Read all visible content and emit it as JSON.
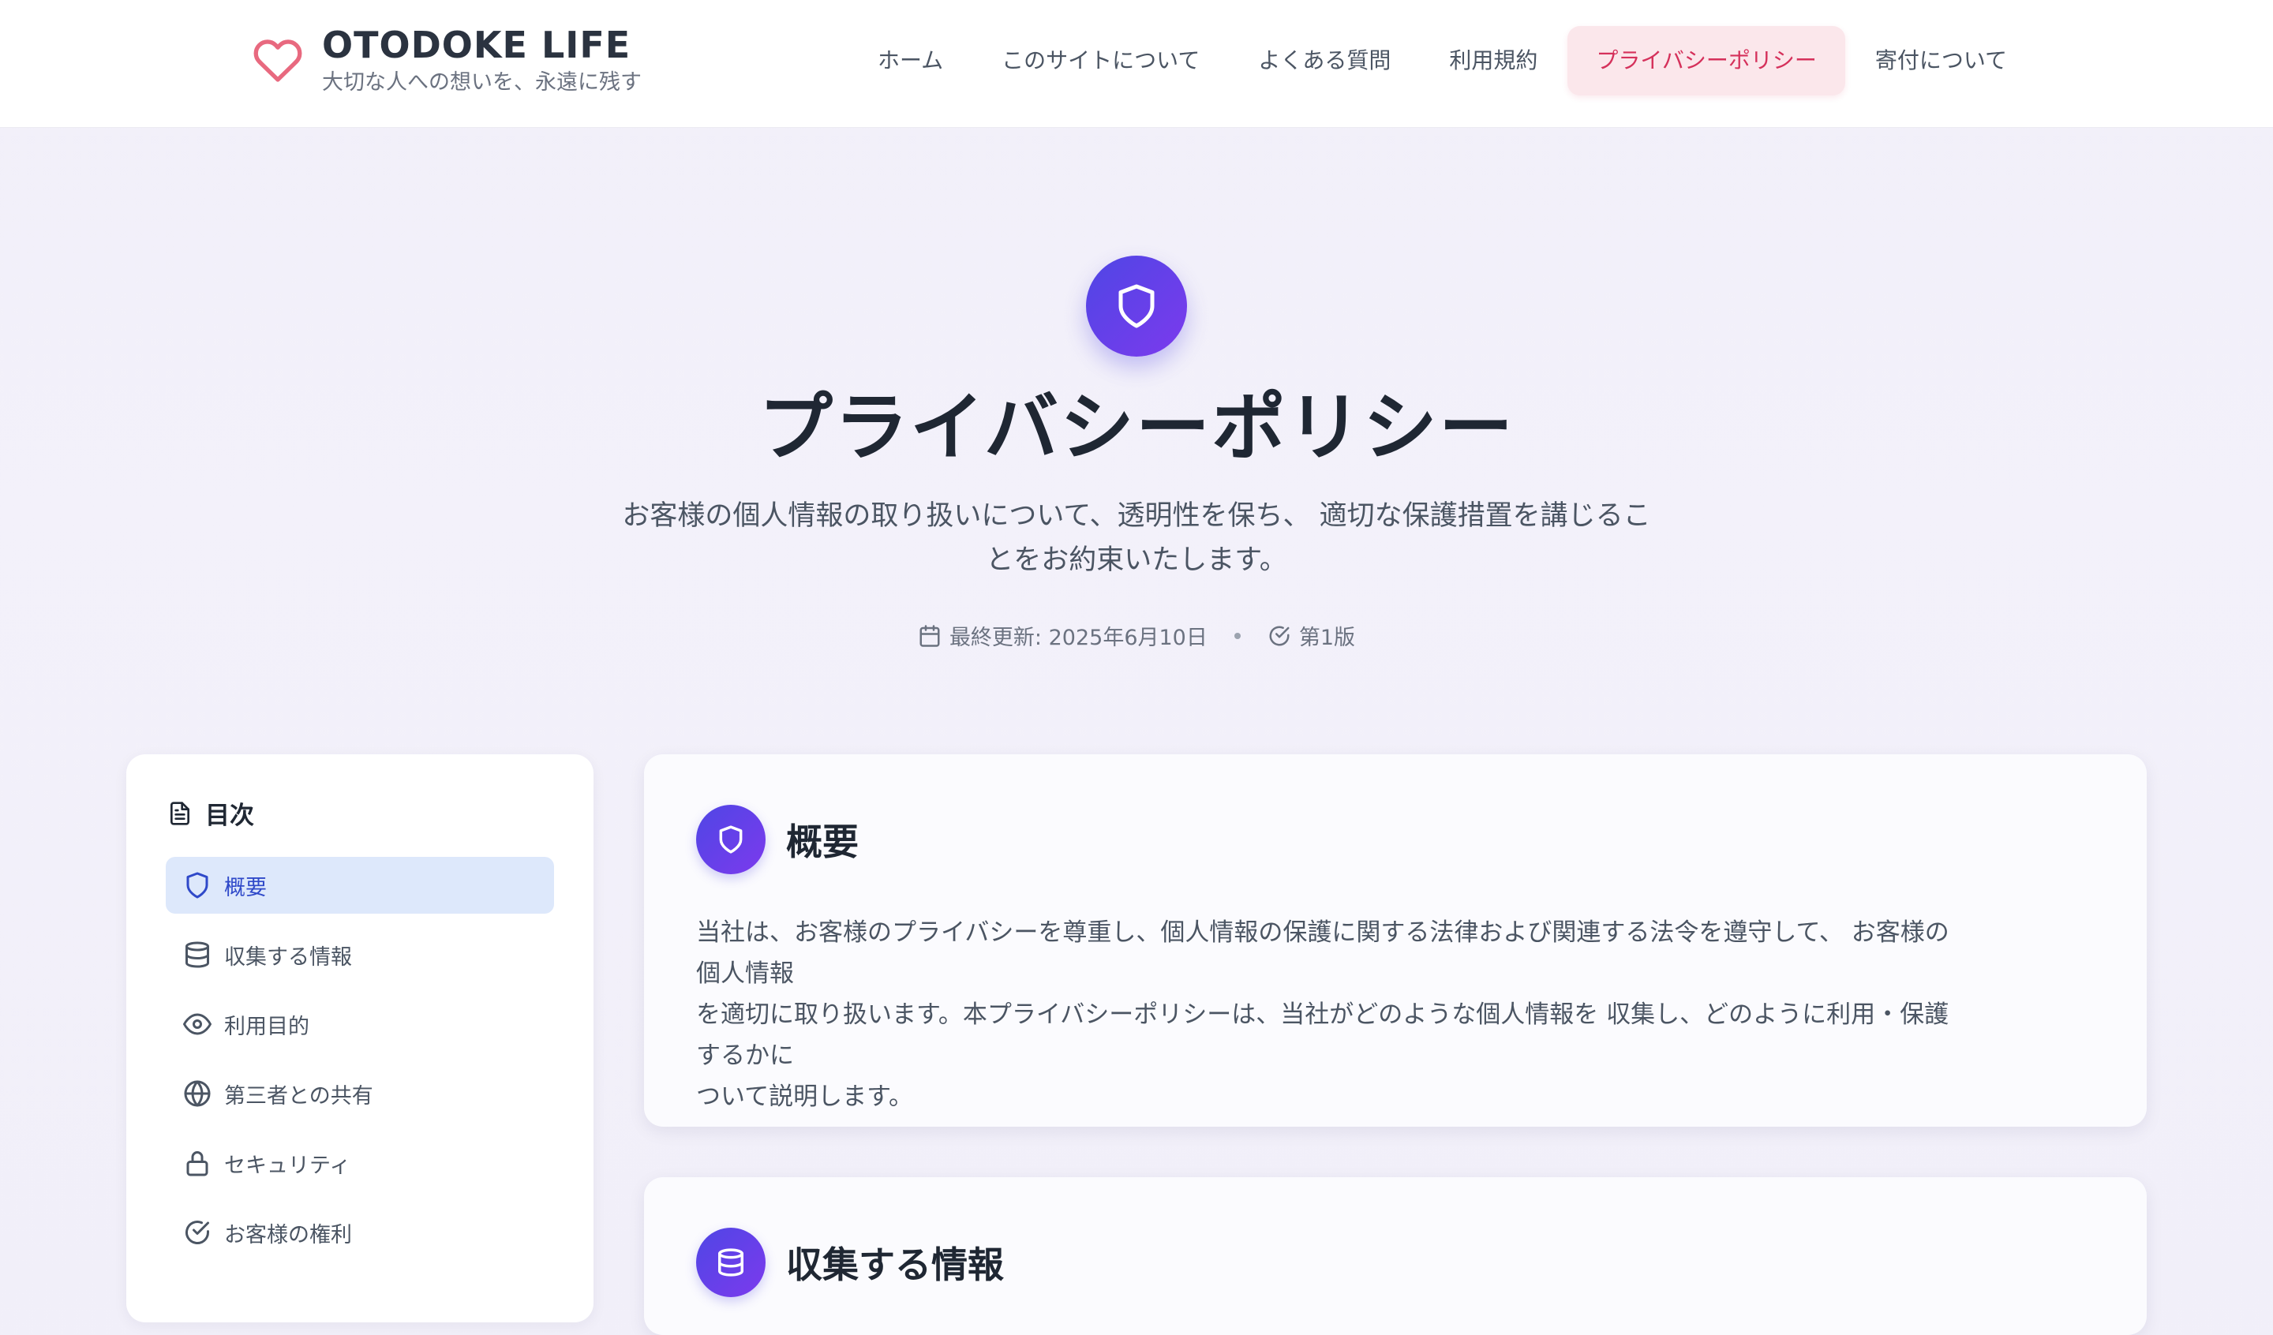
{
  "brand": {
    "title": "OTODOKE LIFE",
    "subtitle": "大切な人への想いを、永遠に残す",
    "icon": "heart-icon"
  },
  "nav": {
    "items": [
      {
        "label": "ホーム"
      },
      {
        "label": "このサイトについて"
      },
      {
        "label": "よくある質問"
      },
      {
        "label": "利用規約"
      },
      {
        "label": "プライバシーポリシー",
        "active": true
      },
      {
        "label": "寄付について"
      }
    ]
  },
  "hero": {
    "icon": "shield-icon",
    "title": "プライバシーポリシー",
    "description_line1": "お客様の個人情報の取り扱いについて、透明性を保ち、 適切な保護措置を講じるこ",
    "description_line2": "とをお約束いたします。",
    "updated": "最終更新: 2025年6月10日",
    "version": "第1版"
  },
  "toc": {
    "title": "目次",
    "items": [
      {
        "label": "概要",
        "icon": "shield-icon",
        "active": true
      },
      {
        "label": "収集する情報",
        "icon": "database-icon"
      },
      {
        "label": "利用目的",
        "icon": "eye-icon"
      },
      {
        "label": "第三者との共有",
        "icon": "globe-icon"
      },
      {
        "label": "セキュリティ",
        "icon": "lock-icon"
      },
      {
        "label": "お客様の権利",
        "icon": "check-circle-icon"
      }
    ]
  },
  "sections": [
    {
      "title": "概要",
      "icon": "shield-icon",
      "body_line1": "当社は、お客様のプライバシーを尊重し、個人情報の保護に関する法律および関連する法令を遵守して、 お客様の個人情報",
      "body_line2": "を適切に取り扱います。本プライバシーポリシーは、当社がどのような個人情報を 収集し、どのように利用・保護するかに",
      "body_line3": "ついて説明します。"
    },
    {
      "title": "収集する情報",
      "icon": "database-icon"
    }
  ],
  "colors": {
    "accent_gradient_start": "#4f46e5",
    "accent_gradient_end": "#7c3aed",
    "nav_active_bg": "#fbe7eb",
    "nav_active_text": "#d5315b",
    "toc_active_bg": "#dde8fb",
    "toc_active_text": "#2f49c9",
    "brand_heart": "#e8697f"
  }
}
